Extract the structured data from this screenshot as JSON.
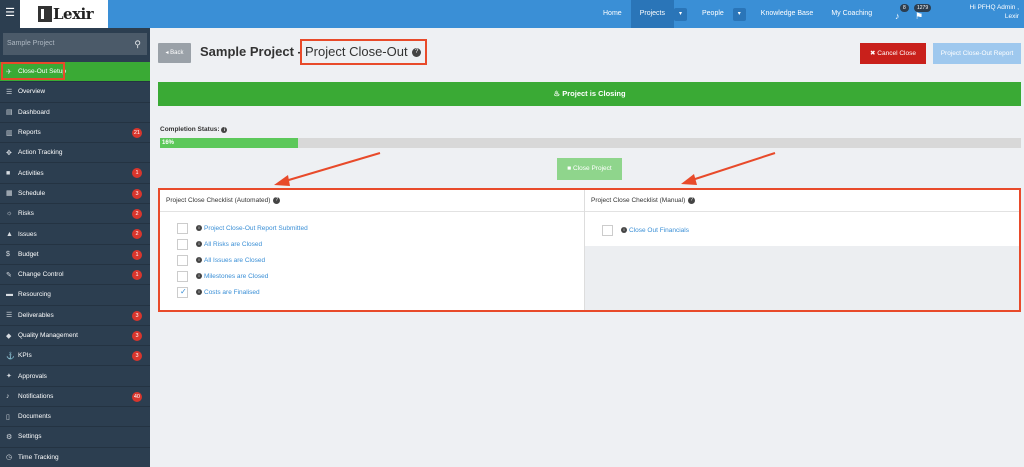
{
  "topbar": {
    "logo_text": "Lexir",
    "nav": [
      {
        "label": "Home",
        "caret": false,
        "active": false
      },
      {
        "label": "Projects",
        "caret": true,
        "active": true
      },
      {
        "label": "People",
        "caret": true,
        "active": false
      },
      {
        "label": "Knowledge Base",
        "caret": false,
        "active": false
      },
      {
        "label": "My Coaching",
        "caret": false,
        "active": false
      }
    ],
    "notif_count": "8",
    "messages_count": "1279",
    "user_line1": "Hi PFHQ Admin ,",
    "user_line2": "Lexir"
  },
  "sidebar": {
    "search_placeholder": "Sample Project",
    "items": [
      {
        "label": "Close-Out Setup",
        "icon": "rocket-icon",
        "glyph": "✈",
        "badge": "",
        "active": true
      },
      {
        "label": "Overview",
        "icon": "list-icon",
        "glyph": "☰",
        "badge": "",
        "active": false
      },
      {
        "label": "Dashboard",
        "icon": "dashboard-icon",
        "glyph": "▤",
        "badge": "",
        "active": false
      },
      {
        "label": "Reports",
        "icon": "bar-chart-icon",
        "glyph": "▥",
        "badge": "21",
        "active": false
      },
      {
        "label": "Action Tracking",
        "icon": "crosshair-icon",
        "glyph": "✥",
        "badge": "",
        "active": false
      },
      {
        "label": "Activities",
        "icon": "bookmark-icon",
        "glyph": "■",
        "badge": "1",
        "active": false
      },
      {
        "label": "Schedule",
        "icon": "calendar-icon",
        "glyph": "▦",
        "badge": "3",
        "active": false
      },
      {
        "label": "Risks",
        "icon": "lightbulb-icon",
        "glyph": "☼",
        "badge": "2",
        "active": false
      },
      {
        "label": "Issues",
        "icon": "warning-icon",
        "glyph": "▲",
        "badge": "2",
        "active": false
      },
      {
        "label": "Budget",
        "icon": "dollar-icon",
        "glyph": "$",
        "badge": "1",
        "active": false
      },
      {
        "label": "Change Control",
        "icon": "edit-icon",
        "glyph": "✎",
        "badge": "1",
        "active": false
      },
      {
        "label": "Resourcing",
        "icon": "folder-icon",
        "glyph": "▬",
        "badge": "",
        "active": false
      },
      {
        "label": "Deliverables",
        "icon": "list-check-icon",
        "glyph": "☰",
        "badge": "3",
        "active": false
      },
      {
        "label": "Quality Management",
        "icon": "tag-icon",
        "glyph": "◆",
        "badge": "3",
        "active": false
      },
      {
        "label": "KPIs",
        "icon": "anchor-icon",
        "glyph": "⚓",
        "badge": "3",
        "active": false
      },
      {
        "label": "Approvals",
        "icon": "gavel-icon",
        "glyph": "✦",
        "badge": "",
        "active": false
      },
      {
        "label": "Notifications",
        "icon": "bell-icon",
        "glyph": "♪",
        "badge": "40",
        "active": false
      },
      {
        "label": "Documents",
        "icon": "document-icon",
        "glyph": "▯",
        "badge": "",
        "active": false
      },
      {
        "label": "Settings",
        "icon": "cogs-icon",
        "glyph": "⚙",
        "badge": "",
        "active": false
      },
      {
        "label": "Time Tracking",
        "icon": "clock-icon",
        "glyph": "◷",
        "badge": "",
        "active": false
      }
    ]
  },
  "main": {
    "back_label": "Back",
    "title": "Sample Project -",
    "subtitle": "Project Close-Out",
    "cancel_label": "Cancel Close",
    "report_label": "Project Close-Out Report",
    "closing_label": "Project is Closing",
    "completion_label": "Completion Status:",
    "completion_percent": 16,
    "completion_text": "16%",
    "close_project_label": "Close Project",
    "automated": {
      "title": "Project Close Checklist (Automated)",
      "items": [
        {
          "label": "Project Close-Out Report Submitted",
          "checked": false
        },
        {
          "label": "All Risks are Closed",
          "checked": false
        },
        {
          "label": "All Issues are Closed",
          "checked": false
        },
        {
          "label": "Milestones are Closed",
          "checked": false
        },
        {
          "label": "Costs are Finalised",
          "checked": true
        }
      ]
    },
    "manual": {
      "title": "Project Close Checklist (Manual)",
      "items": [
        {
          "label": "Close Out Financials",
          "checked": false
        }
      ]
    }
  },
  "colors": {
    "topbar": "#3a8fd6",
    "sidebar": "#2c3e50",
    "accent_green": "#3aaa35",
    "danger": "#c9201b",
    "highlight": "#e84a2a"
  }
}
